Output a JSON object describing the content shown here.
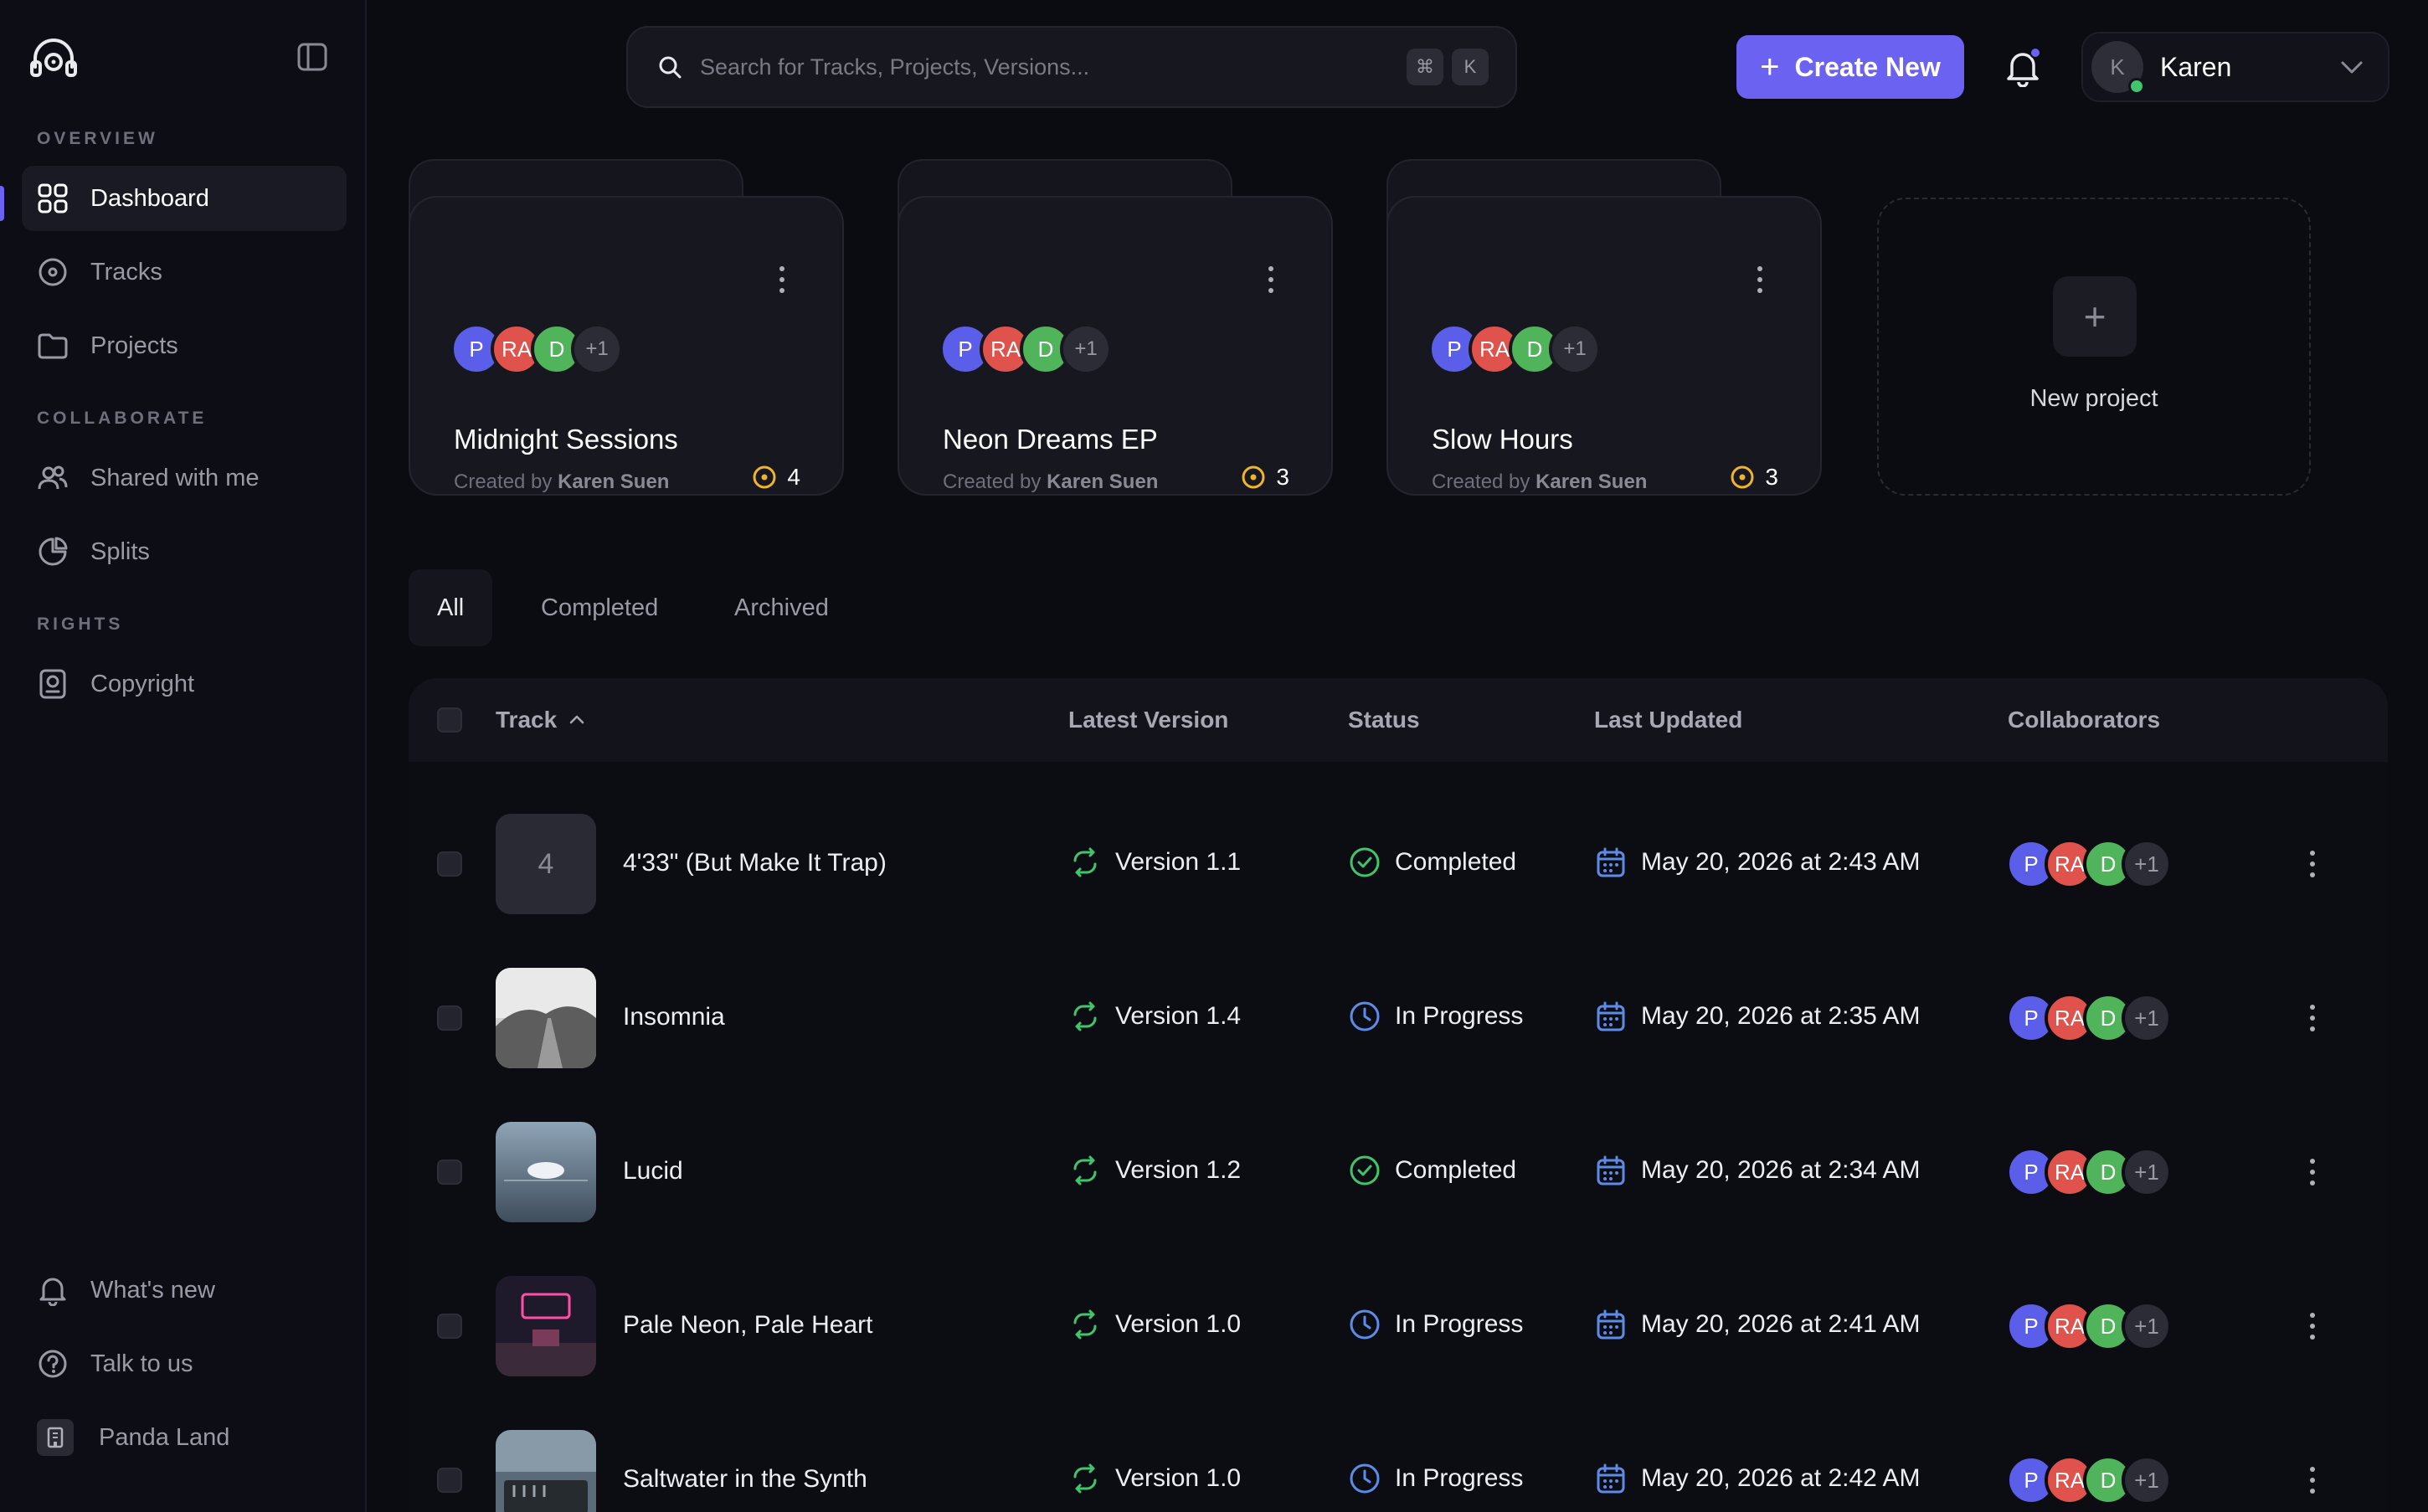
{
  "app": {
    "brand": "headphones-logo"
  },
  "sidebar": {
    "sections": {
      "overview": "OVERVIEW",
      "collaborate": "COLLABORATE",
      "rights": "RIGHTS"
    },
    "items": [
      {
        "label": "Dashboard",
        "icon": "grid-icon",
        "active": true
      },
      {
        "label": "Tracks",
        "icon": "disc-icon"
      },
      {
        "label": "Projects",
        "icon": "folder-icon"
      },
      {
        "label": "Shared with me",
        "icon": "users-icon"
      },
      {
        "label": "Splits",
        "icon": "pie-chart-icon"
      },
      {
        "label": "Copyright",
        "icon": "copyright-doc-icon"
      }
    ],
    "footer": [
      {
        "label": "What's new",
        "icon": "bell-icon"
      },
      {
        "label": "Talk to us",
        "icon": "help-icon"
      },
      {
        "label": "Panda Land",
        "icon": "building-icon"
      }
    ]
  },
  "header": {
    "search_placeholder": "Search for Tracks, Projects, Versions...",
    "shortcut": [
      "⌘",
      "K"
    ],
    "create_label": "Create New",
    "user_name": "Karen",
    "user_initial": "K"
  },
  "projects": [
    {
      "title": "Midnight Sessions",
      "created_by_prefix": "Created by",
      "creator": "Karen Suen",
      "count": "4",
      "avatars": [
        "P",
        "RA",
        "D"
      ],
      "more": "+1"
    },
    {
      "title": "Neon Dreams EP",
      "created_by_prefix": "Created by",
      "creator": "Karen Suen",
      "count": "3",
      "avatars": [
        "P",
        "RA",
        "D"
      ],
      "more": "+1"
    },
    {
      "title": "Slow Hours",
      "created_by_prefix": "Created by",
      "creator": "Karen Suen",
      "count": "3",
      "avatars": [
        "P",
        "RA",
        "D"
      ],
      "more": "+1"
    }
  ],
  "new_project_label": "New project",
  "tabs": [
    {
      "label": "All",
      "active": true
    },
    {
      "label": "Completed"
    },
    {
      "label": "Archived"
    }
  ],
  "table": {
    "columns": [
      "Track",
      "Latest Version",
      "Status",
      "Last Updated",
      "Collaborators"
    ],
    "rows": [
      {
        "placeholder": "4",
        "name": "4'33\" (But Make It Trap)",
        "version": "Version 1.1",
        "status": "Completed",
        "updated": "May 20, 2026 at 2:43 AM"
      },
      {
        "name": "Insomnia",
        "version": "Version 1.4",
        "status": "In Progress",
        "updated": "May 20, 2026 at 2:35 AM"
      },
      {
        "name": "Lucid",
        "version": "Version 1.2",
        "status": "Completed",
        "updated": "May 20, 2026 at 2:34 AM"
      },
      {
        "name": "Pale Neon, Pale Heart",
        "version": "Version 1.0",
        "status": "In Progress",
        "updated": "May 20, 2026 at 2:41 AM"
      },
      {
        "name": "Saltwater in the Synth",
        "version": "Version 1.0",
        "status": "In Progress",
        "updated": "May 20, 2026 at 2:42 AM"
      }
    ],
    "collaborators": [
      "P",
      "RA",
      "D"
    ],
    "collaborators_more": "+1"
  },
  "colors": {
    "accent": "#6b62f2",
    "avatar_p": "#5b5ee8",
    "avatar_ra": "#e0524c",
    "avatar_d": "#4fb45a",
    "completed": "#3fc56b",
    "in_progress": "#5b8de8",
    "count_icon": "#f0b429",
    "calendar": "#5b8de8"
  }
}
